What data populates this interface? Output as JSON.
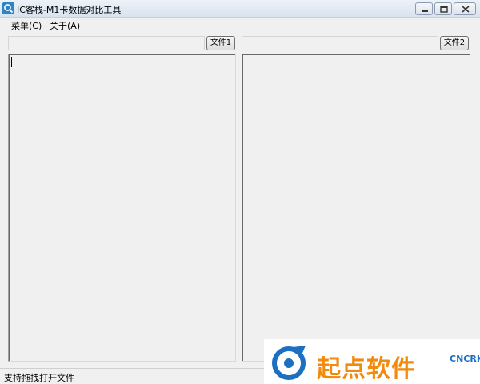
{
  "window": {
    "title": "IC客栈-M1卡数据对比工具",
    "icon": "magnifier-icon",
    "controls": [
      "minimize-icon",
      "maximize-icon",
      "close-icon"
    ]
  },
  "menu": {
    "items": [
      {
        "label": "菜单(C)"
      },
      {
        "label": "关于(A)"
      }
    ]
  },
  "panels": {
    "left": {
      "path_value": "",
      "button_label": "文件1",
      "content": ""
    },
    "right": {
      "path_value": "",
      "button_label": "文件2",
      "content": ""
    }
  },
  "status": {
    "text": "支持拖拽打开文件"
  },
  "watermark": {
    "text": "起点软件",
    "domain": "CNCRK",
    "colors": {
      "text": "#f28a0e",
      "logo": "#1d6fc1"
    }
  }
}
